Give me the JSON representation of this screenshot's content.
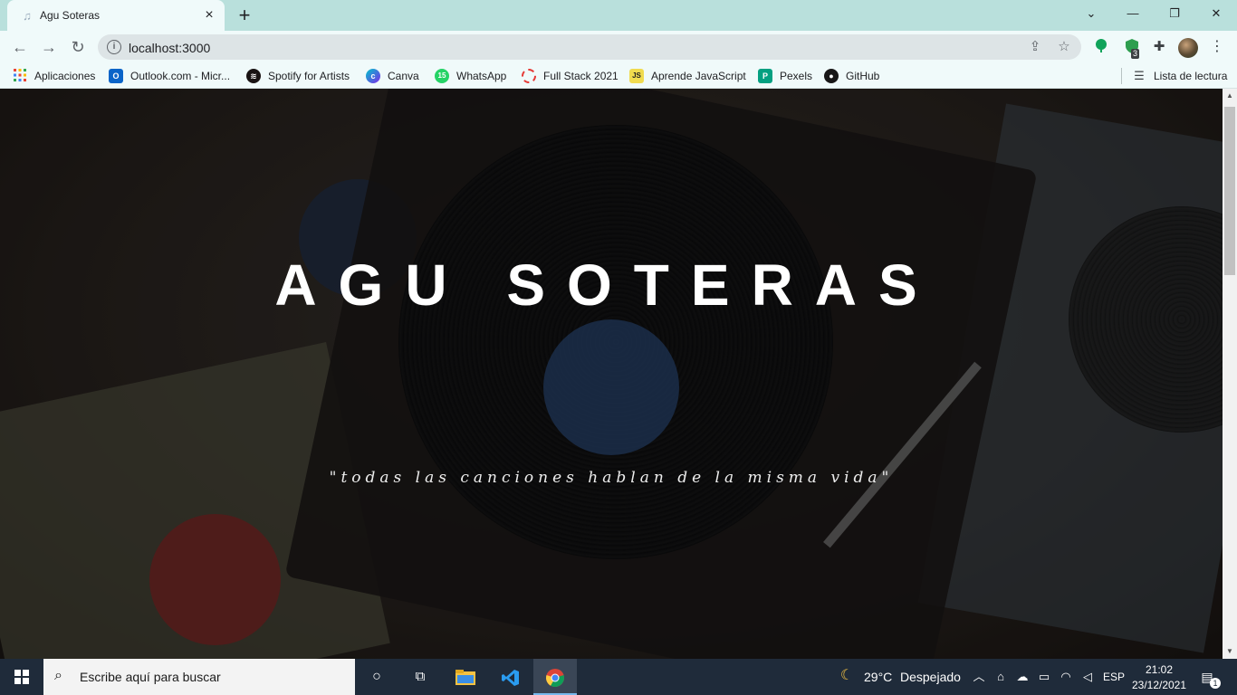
{
  "browser": {
    "tab": {
      "title": "Agu Soteras",
      "favicon": "music-note-icon"
    },
    "new_tab": "+",
    "window_controls": {
      "dropdown": "⌄",
      "minimize": "—",
      "restore": "❐",
      "close": "✕"
    },
    "address": {
      "url": "localhost:3000"
    },
    "extension_badge": "3",
    "bookmarks": [
      {
        "label": "Aplicaciones",
        "icon": "apps-grid-icon",
        "color": "#e94235"
      },
      {
        "label": "Outlook.com - Micr...",
        "icon": "outlook-icon",
        "color": "#0a64c8"
      },
      {
        "label": "Spotify for Artists",
        "icon": "spotify-icon",
        "color": "#191414"
      },
      {
        "label": "Canva",
        "icon": "canva-icon",
        "color": "#7d2ae8"
      },
      {
        "label": "WhatsApp",
        "icon": "whatsapp-icon",
        "color": "#25d366"
      },
      {
        "label": "Full Stack 2021",
        "icon": "fullstack-icon",
        "color": "#e53935"
      },
      {
        "label": "Aprende JavaScript",
        "icon": "javascript-icon",
        "color": "#f0db4f"
      },
      {
        "label": "Pexels",
        "icon": "pexels-icon",
        "color": "#05a081"
      },
      {
        "label": "GitHub",
        "icon": "github-icon",
        "color": "#181717"
      }
    ],
    "reading_list": "Lista de lectura"
  },
  "hero": {
    "title": "AGU SOTERAS",
    "quote": "\"todas las canciones hablan de la misma vida\""
  },
  "taskbar": {
    "search_placeholder": "Escribe aquí para buscar",
    "weather": {
      "temp": "29°C",
      "condition": "Despejado"
    },
    "language": "ESP",
    "time": "21:02",
    "date": "23/12/2021",
    "notifications": "1"
  }
}
